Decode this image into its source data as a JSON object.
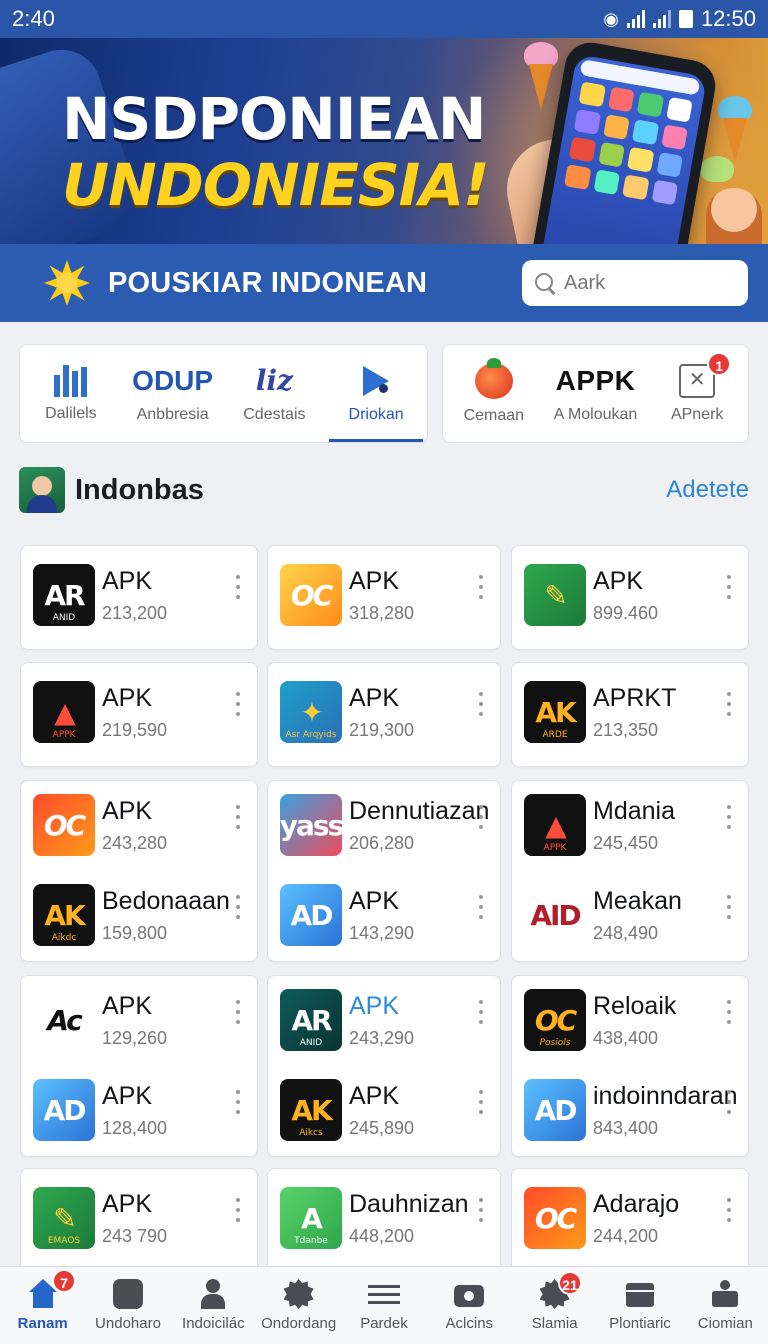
{
  "status": {
    "time_left": "2:40",
    "time_right": "12:50"
  },
  "hero": {
    "line1": "NSDPONIEAN",
    "line2": "UNDONIESIA!"
  },
  "subhead": {
    "title": "POUSKIAR INDONEAN",
    "search_placeholder": "Aark"
  },
  "categories_left": [
    {
      "glyph": "bars-icon",
      "label": "Dalilels"
    },
    {
      "glyph": "ODUP",
      "label": "Anbbresia"
    },
    {
      "glyph": "liz",
      "label": "Cdestais"
    },
    {
      "glyph": "play-icon",
      "label": "Driokan",
      "active": true
    }
  ],
  "categories_right": [
    {
      "glyph": "tomato-icon",
      "label": "Cemaan"
    },
    {
      "glyph": "APPK",
      "label": "A Moloukan"
    },
    {
      "glyph": "box-icon",
      "label": "APnerk",
      "badge": "1"
    }
  ],
  "section": {
    "title": "Indonbas",
    "link": "Adetete"
  },
  "apps": [
    {
      "name": "APK",
      "count": "213,200",
      "icon": "AR",
      "sub": "ANID"
    },
    {
      "name": "APK",
      "count": "318,280",
      "icon": "OC",
      "sub": ""
    },
    {
      "name": "APK",
      "count": "899.460",
      "icon": "✎",
      "sub": ""
    },
    {
      "name": "APK",
      "count": "219,590",
      "icon": "▲",
      "sub": "APPK"
    },
    {
      "name": "APK",
      "count": "219,300",
      "icon": "✦",
      "sub": "Asr Arqyids"
    },
    {
      "name": "APRKT",
      "count": "213,350",
      "icon": "AK",
      "sub": "ARDE"
    },
    {
      "name": "APK",
      "count": "243,280",
      "icon": "OC",
      "sub": ""
    },
    {
      "name": "Bedonaaan",
      "count": "159,800",
      "icon": "AK",
      "sub": "Aikdc"
    },
    {
      "name": "Dennutiazan",
      "count": "206,280",
      "icon": "yass",
      "sub": ""
    },
    {
      "name": "APK",
      "count": "143,290",
      "icon": "AD",
      "sub": ""
    },
    {
      "name": "Mdania",
      "count": "245,450",
      "icon": "▲",
      "sub": "APPK"
    },
    {
      "name": "Meakan",
      "count": "248,490",
      "icon": "AID",
      "sub": ""
    },
    {
      "name": "APK",
      "count": "129,260",
      "icon": "Ac",
      "sub": ""
    },
    {
      "name": "APK",
      "count": "128,400",
      "icon": "AD",
      "sub": ""
    },
    {
      "name": "APK",
      "count": "243,290",
      "icon": "AR",
      "sub": "ANID",
      "blue": true
    },
    {
      "name": "APK",
      "count": "245,890",
      "icon": "AK",
      "sub": "Aikcs"
    },
    {
      "name": "Reloaik",
      "count": "438,400",
      "icon": "OC",
      "sub": "Posiols"
    },
    {
      "name": "indoinndaran",
      "count": "843,400",
      "icon": "AD",
      "sub": ""
    },
    {
      "name": "APK",
      "count": "243 790",
      "icon": "✎",
      "sub": "EMAOS"
    },
    {
      "name": "Dauhnizan",
      "count": "448,200",
      "icon": "A",
      "sub": "Tdanbe"
    },
    {
      "name": "Adarajo",
      "count": "244,200",
      "icon": "OC",
      "sub": ""
    }
  ],
  "nav": [
    {
      "label": "Ranam",
      "icon": "home-icon",
      "badge": "7",
      "active": true
    },
    {
      "label": "Undoharo",
      "icon": "app-icon"
    },
    {
      "label": "Indoicilác",
      "icon": "person-icon"
    },
    {
      "label": "Ondordang",
      "icon": "settings-icon"
    },
    {
      "label": "Pardek",
      "icon": "menu-icon"
    },
    {
      "label": "Aclcins",
      "icon": "camera-icon"
    },
    {
      "label": "Slamia",
      "icon": "gear-icon",
      "badge": "21"
    },
    {
      "label": "Plontiaric",
      "icon": "box-icon"
    },
    {
      "label": "Ciomian",
      "icon": "tools-icon"
    }
  ]
}
